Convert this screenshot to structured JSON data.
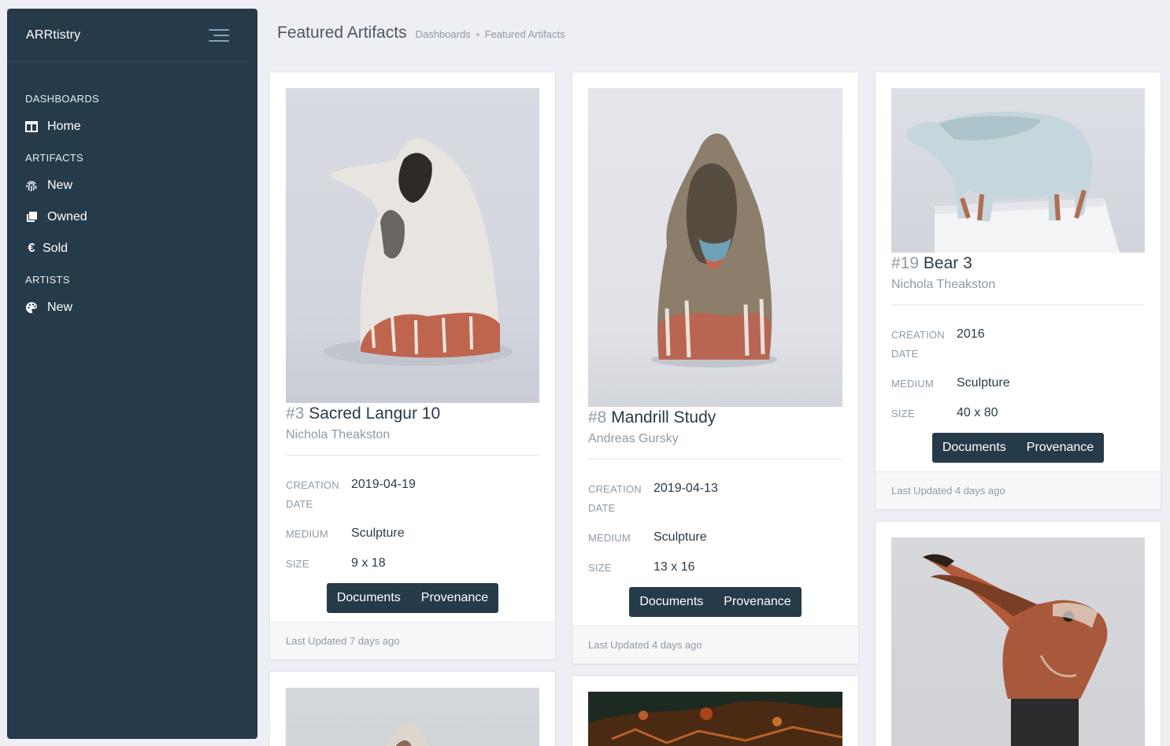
{
  "app": {
    "brand": "ARRtistry"
  },
  "sidebar": {
    "sections": [
      {
        "heading": "DASHBOARDS",
        "items": [
          {
            "label": "Home",
            "icon": "columns-icon"
          }
        ]
      },
      {
        "heading": "ARTIFACTS",
        "items": [
          {
            "label": "New",
            "icon": "fingerprint-icon"
          },
          {
            "label": "Owned",
            "icon": "clone-icon"
          },
          {
            "label": "Sold",
            "icon": "euro-icon"
          }
        ]
      },
      {
        "heading": "ARTISTS",
        "items": [
          {
            "label": "New",
            "icon": "palette-icon"
          }
        ]
      }
    ]
  },
  "header": {
    "title": "Featured Artifacts",
    "breadcrumbs": [
      "Dashboards",
      "Featured Artifacts"
    ]
  },
  "labels": {
    "creation": "CREATION",
    "date": "DATE",
    "medium": "MEDIUM",
    "size": "SIZE",
    "documents": "Documents",
    "provenance": "Provenance"
  },
  "cards": [
    {
      "number": "#3",
      "title": "Sacred Langur 10",
      "artist": "Nichola Theakston",
      "creation_date": "2019-04-19",
      "medium": "Sculpture",
      "size": "9 x 18",
      "updated": "Last Updated 7 days ago"
    },
    {
      "number": "#8",
      "title": "Mandrill Study",
      "artist": "Andreas Gursky",
      "creation_date": "2019-04-13",
      "medium": "Sculpture",
      "size": "13 x 16",
      "updated": "Last Updated 4 days ago"
    },
    {
      "number": "#19",
      "title": "Bear 3",
      "artist": "Nichola Theakston",
      "creation_date": "2016",
      "medium": "Sculpture",
      "size": "40 x 80",
      "updated": "Last Updated 4 days ago"
    }
  ]
}
